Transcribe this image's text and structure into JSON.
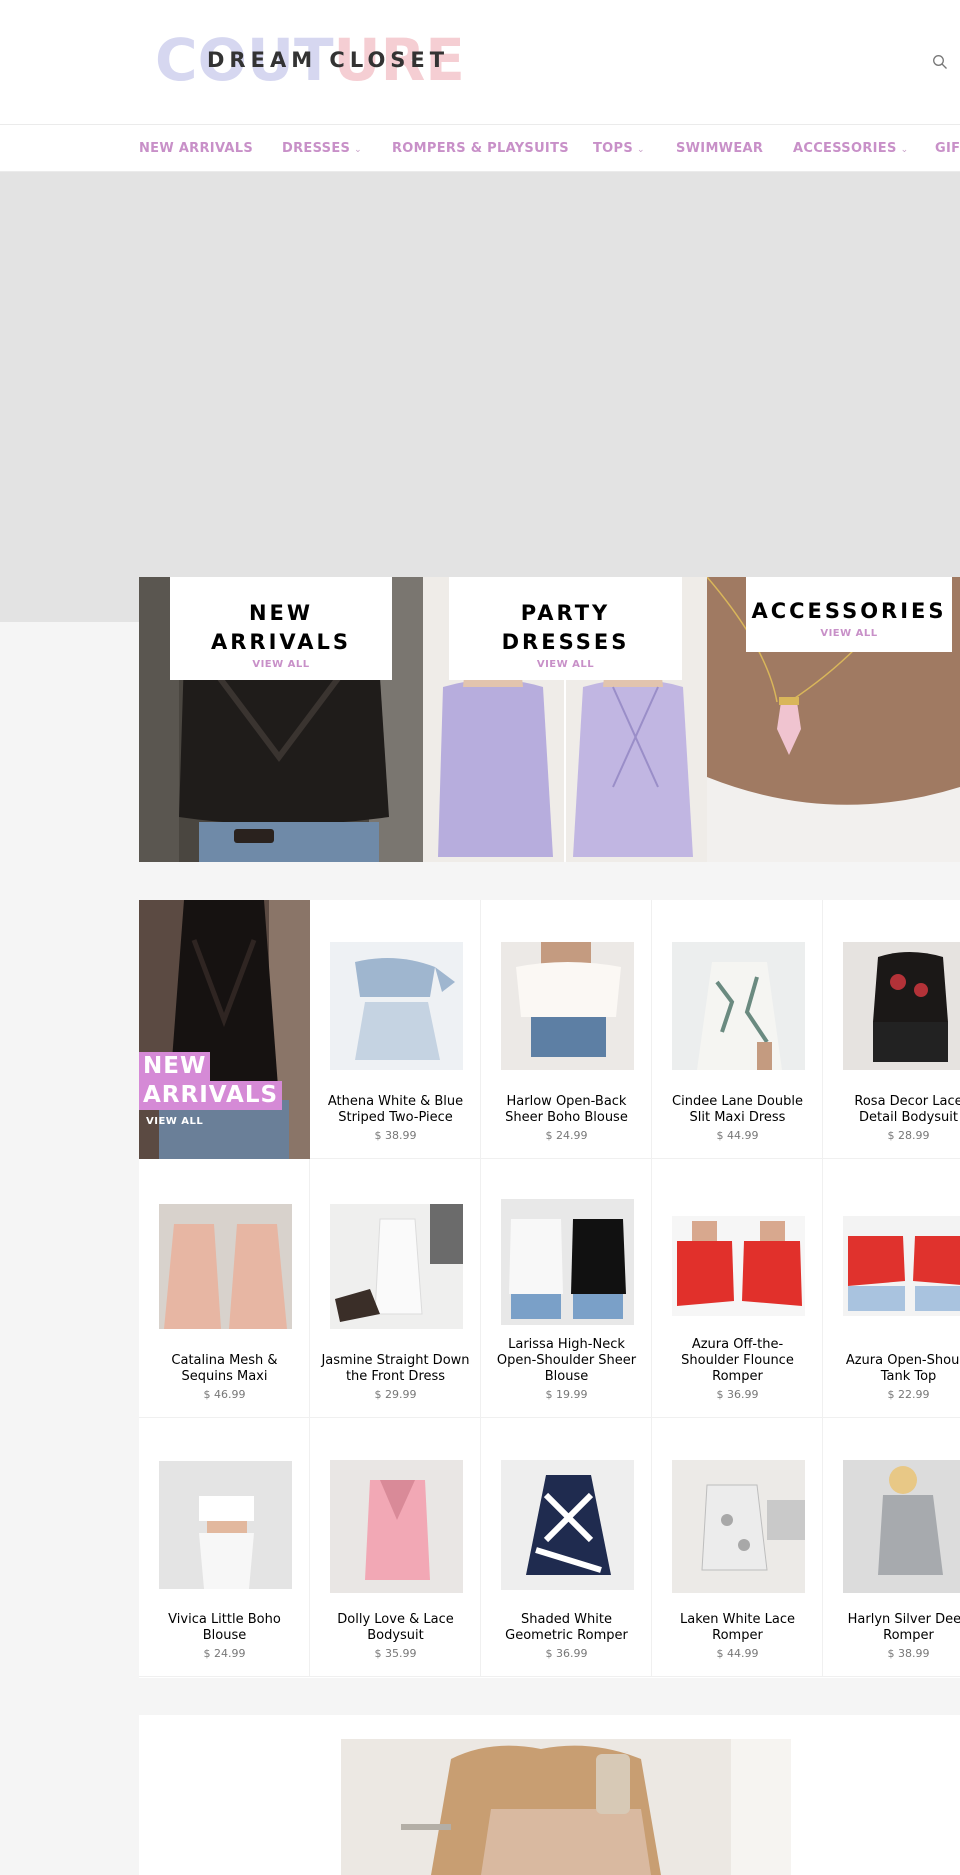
{
  "header": {
    "logo_script": "COUTURE",
    "logo_text": "DREAM CLOSET",
    "search_icon": "search-icon"
  },
  "nav": {
    "items": [
      {
        "label": "NEW ARRIVALS",
        "dropdown": false
      },
      {
        "label": "DRESSES",
        "dropdown": true
      },
      {
        "label": "ROMPERS & PLAYSUITS",
        "dropdown": false
      },
      {
        "label": "TOPS",
        "dropdown": true
      },
      {
        "label": "SWIMWEAR",
        "dropdown": false
      },
      {
        "label": "ACCESSORIES",
        "dropdown": true
      },
      {
        "label": "GIF",
        "dropdown": false
      }
    ],
    "chevron": "⌄"
  },
  "collections": [
    {
      "title": "NEW ARRIVALS",
      "title_lines": [
        "NEW",
        "ARRIVALS"
      ],
      "link": "VIEW ALL"
    },
    {
      "title": "PARTY DRESSES",
      "title_lines": [
        "PARTY",
        "DRESSES"
      ],
      "link": "VIEW ALL"
    },
    {
      "title": "ACCESSORIES",
      "title_lines": [
        "ACCESSORIES"
      ],
      "link": "VIEW ALL"
    }
  ],
  "featured": {
    "title_lines": [
      "NEW",
      "ARRIVALS"
    ],
    "link": "VIEW ALL"
  },
  "products": [
    {
      "name_lines": [
        "Athena White & Blue",
        "Striped Two-Piece"
      ],
      "price": "$ 38.99"
    },
    {
      "name_lines": [
        "Harlow Open-Back",
        "Sheer Boho Blouse"
      ],
      "price": "$ 24.99"
    },
    {
      "name_lines": [
        "Cindee Lane Double",
        "Slit Maxi Dress"
      ],
      "price": "$ 44.99"
    },
    {
      "name_lines": [
        "Rosa Decor Lace",
        "Detail Bodysuit"
      ],
      "price": "$ 28.99"
    },
    {
      "name_lines": [
        "Catalina Mesh &",
        "Sequins Maxi"
      ],
      "price": "$ 46.99"
    },
    {
      "name_lines": [
        "Jasmine Straight Down",
        "the Front Dress"
      ],
      "price": "$ 29.99"
    },
    {
      "name_lines": [
        "Larissa High-Neck",
        "Open-Shoulder Sheer",
        "Blouse"
      ],
      "price": "$ 19.99"
    },
    {
      "name_lines": [
        "Azura Off-the-",
        "Shoulder Flounce",
        "Romper"
      ],
      "price": "$ 36.99"
    },
    {
      "name_lines": [
        "Azura Open-Should",
        "Tank Top"
      ],
      "price": "$ 22.99"
    },
    {
      "name_lines": [
        "Vivica Little Boho",
        "Blouse"
      ],
      "price": "$ 24.99"
    },
    {
      "name_lines": [
        "Dolly Love & Lace",
        "Bodysuit"
      ],
      "price": "$ 35.99"
    },
    {
      "name_lines": [
        "Shaded White",
        "Geometric Romper"
      ],
      "price": "$ 36.99"
    },
    {
      "name_lines": [
        "Laken White Lace",
        "Romper"
      ],
      "price": "$ 44.99"
    },
    {
      "name_lines": [
        "Harlyn Silver Deep",
        "Romper"
      ],
      "price": "$ 38.99"
    }
  ],
  "colors": {
    "accent": "#c890c8",
    "badge": "#d58ad6",
    "hero": "#e3e3e3",
    "page_bg": "#f5f5f5"
  }
}
